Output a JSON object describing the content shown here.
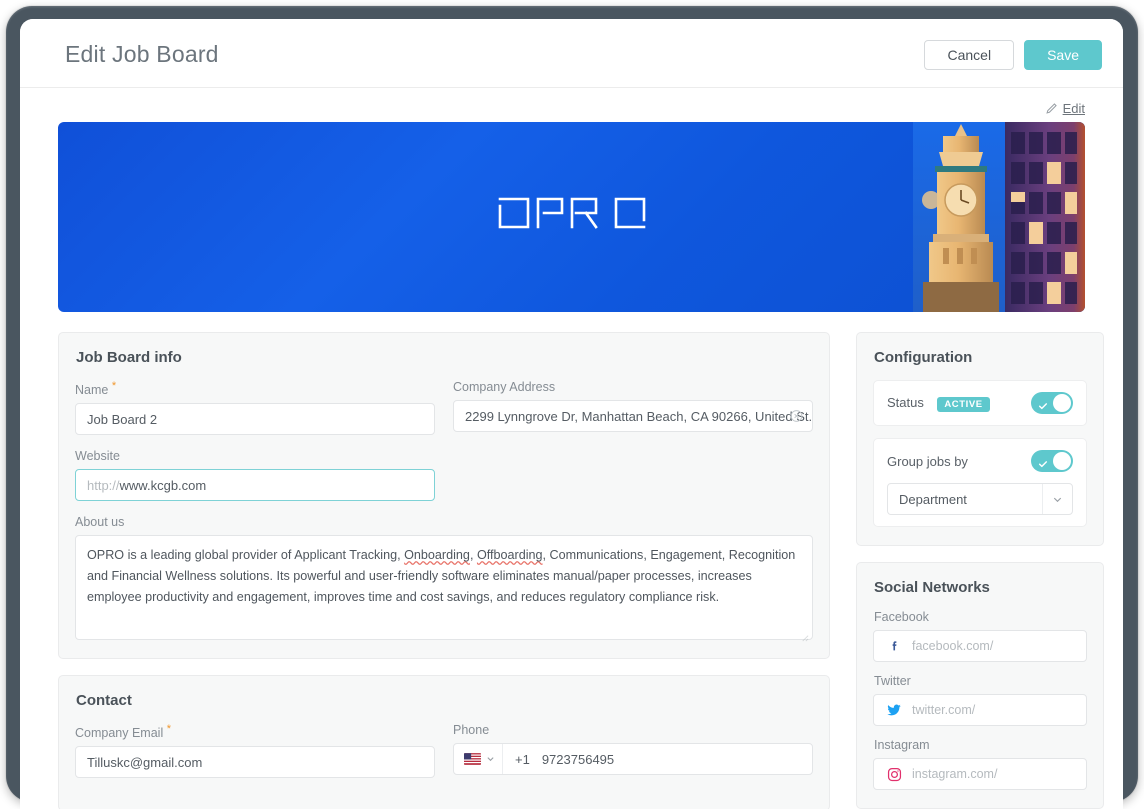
{
  "window": {
    "title": "Edit Job Board"
  },
  "header": {
    "title": "Edit Job Board",
    "cancel_label": "Cancel",
    "save_label": "Save",
    "save_color": "#5ec8cd"
  },
  "banner": {
    "edit_label": "Edit",
    "edit_icon": "pencil-icon",
    "logo_text": "OPRO",
    "background_color": "#1560e8",
    "photo_description": "clock-tower-at-dusk-photo"
  },
  "job_board_info": {
    "title": "Job Board info",
    "name": {
      "label": "Name",
      "required": true,
      "value": "Job Board 2"
    },
    "company_address": {
      "label": "Company Address",
      "required": false,
      "value": "2299 Lynngrove Dr, Manhattan Beach, CA 90266, United St...",
      "clear_icon": "clear-circle-icon"
    },
    "website": {
      "label": "Website",
      "required": false,
      "prefix": "http://",
      "value": "www.kcgb.com",
      "focused": true
    },
    "about_us": {
      "label": "About us",
      "value": "OPRO is a leading global provider of Applicant Tracking, Onboarding, Offboarding, Communications, Engagement, Recognition and Financial Wellness solutions. Its powerful and user-friendly software eliminates manual/paper processes, increases employee productivity and engagement, improves time and cost savings, and reduces regulatory compliance risk.",
      "misspelled_words": [
        "Onboarding",
        "Offboarding"
      ],
      "segments": [
        {
          "text": "OPRO is a leading global provider of Applicant Tracking, ",
          "spell": false
        },
        {
          "text": "Onboarding",
          "spell": true
        },
        {
          "text": ", ",
          "spell": false
        },
        {
          "text": "Offboarding",
          "spell": true
        },
        {
          "text": ", Communications, Engagement, Recognition and Financial Wellness solutions. Its powerful and user-friendly software eliminates manual/paper processes, increases employee productivity and engagement, improves time and cost savings, and reduces regulatory compliance risk.",
          "spell": false
        }
      ]
    }
  },
  "contact": {
    "title": "Contact",
    "company_email": {
      "label": "Company Email",
      "required": true,
      "value": "Tilluskc@gmail.com"
    },
    "phone": {
      "label": "Phone",
      "country_flag": "us-flag-icon",
      "dial_code": "+1",
      "value": "9723756495"
    }
  },
  "configuration": {
    "title": "Configuration",
    "status": {
      "label": "Status",
      "badge": "ACTIVE",
      "badge_color": "#5ec8cd",
      "toggle_on": true
    },
    "group_jobs_by": {
      "label": "Group jobs by",
      "toggle_on": true,
      "selected": "Department",
      "options": [
        "Department"
      ]
    }
  },
  "social_networks": {
    "title": "Social Networks",
    "items": [
      {
        "label": "Facebook",
        "icon": "facebook-icon",
        "placeholder": "facebook.com/",
        "value": "",
        "color": "#3b5998"
      },
      {
        "label": "Twitter",
        "icon": "twitter-icon",
        "placeholder": "twitter.com/",
        "value": "",
        "color": "#1da1f2"
      },
      {
        "label": "Instagram",
        "icon": "instagram-icon",
        "placeholder": "instagram.com/",
        "value": "",
        "color": "#e1306c"
      }
    ]
  }
}
